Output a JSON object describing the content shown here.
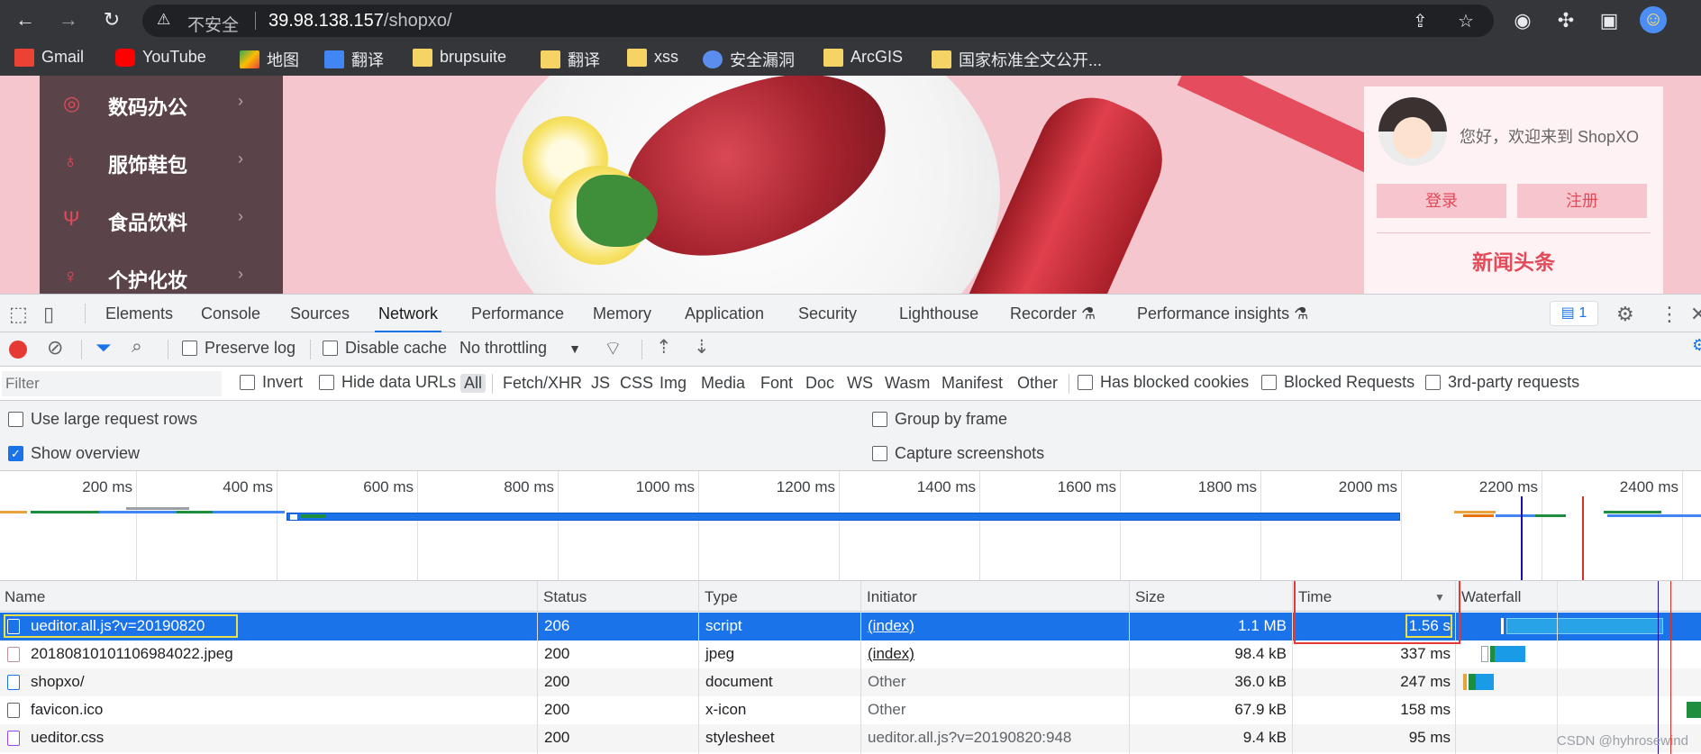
{
  "browser": {
    "insecure_label": "不安全",
    "url_host": "39.98.138.157",
    "url_path": "/shopxo/",
    "bookmarks": [
      {
        "label": "Gmail",
        "icon": "gmail-icon",
        "color": "#ea4335"
      },
      {
        "label": "YouTube",
        "icon": "youtube-icon",
        "color": "#ff0000"
      },
      {
        "label": "地图",
        "icon": "maps-icon",
        "color": "#34a853"
      },
      {
        "label": "翻译",
        "icon": "translate-icon",
        "color": "#4285f4"
      },
      {
        "label": "brupsuite",
        "icon": "folder-icon",
        "color": "#f6d365"
      },
      {
        "label": "翻译",
        "icon": "folder-icon",
        "color": "#f6d365"
      },
      {
        "label": "xss",
        "icon": "folder-icon",
        "color": "#f6d365"
      },
      {
        "label": "安全漏洞",
        "icon": "site-icon",
        "color": "#5b8def"
      },
      {
        "label": "ArcGIS",
        "icon": "folder-icon",
        "color": "#f6d365"
      },
      {
        "label": "国家标准全文公开...",
        "icon": "folder-icon",
        "color": "#f6d365"
      }
    ]
  },
  "page": {
    "categories": [
      {
        "label": "数码办公",
        "icon": "camera-icon"
      },
      {
        "label": "服饰鞋包",
        "icon": "shirt-icon"
      },
      {
        "label": "食品饮料",
        "icon": "cutlery-icon"
      },
      {
        "label": "个护化妆",
        "icon": "cosmetics-icon"
      }
    ],
    "welcome": "您好，欢迎来到 ShopXO",
    "login_label": "登录",
    "register_label": "注册",
    "news_heading": "新闻头条"
  },
  "devtools": {
    "tabs": [
      "Elements",
      "Console",
      "Sources",
      "Network",
      "Performance",
      "Memory",
      "Application",
      "Security",
      "Lighthouse",
      "Recorder",
      "Performance insights"
    ],
    "active_tab": "Network",
    "issues_count": "1",
    "toolbar": {
      "preserve_log": "Preserve log",
      "disable_cache": "Disable cache",
      "throttling": "No throttling"
    },
    "filter": {
      "placeholder": "Filter",
      "invert": "Invert",
      "hide_data_urls": "Hide data URLs",
      "types": [
        "All",
        "Fetch/XHR",
        "JS",
        "CSS",
        "Img",
        "Media",
        "Font",
        "Doc",
        "WS",
        "Wasm",
        "Manifest",
        "Other"
      ],
      "selected_type": "All",
      "has_blocked_cookies": "Has blocked cookies",
      "blocked_requests": "Blocked Requests",
      "third_party": "3rd-party requests"
    },
    "settings": {
      "large_rows": "Use large request rows",
      "group_by_frame": "Group by frame",
      "show_overview": "Show overview",
      "capture_screenshots": "Capture screenshots",
      "show_overview_checked": true
    },
    "overview_ticks": [
      "200 ms",
      "400 ms",
      "600 ms",
      "800 ms",
      "1000 ms",
      "1200 ms",
      "1400 ms",
      "1600 ms",
      "1800 ms",
      "2000 ms",
      "2200 ms",
      "2400 ms"
    ],
    "columns": [
      "Name",
      "Status",
      "Type",
      "Initiator",
      "Size",
      "Time",
      "Waterfall"
    ],
    "rows": [
      {
        "name": "ueditor.all.js?v=20190820",
        "status": "206",
        "type": "script",
        "initiator": "(index)",
        "size": "1.1 MB",
        "time": "1.56 s",
        "icon": "script-file-icon"
      },
      {
        "name": "20180810101106984022.jpeg",
        "status": "200",
        "type": "jpeg",
        "initiator": "(index)",
        "size": "98.4 kB",
        "time": "337 ms",
        "icon": "image-file-icon"
      },
      {
        "name": "shopxo/",
        "status": "200",
        "type": "document",
        "initiator": "Other",
        "size": "36.0 kB",
        "time": "247 ms",
        "icon": "document-file-icon"
      },
      {
        "name": "favicon.ico",
        "status": "200",
        "type": "x-icon",
        "initiator": "Other",
        "size": "67.9 kB",
        "time": "158 ms",
        "icon": "file-icon"
      },
      {
        "name": "ueditor.css",
        "status": "200",
        "type": "stylesheet",
        "initiator": "ueditor.all.js?v=20190820:948",
        "size": "9.4 kB",
        "time": "95 ms",
        "icon": "stylesheet-file-icon"
      }
    ]
  },
  "watermark": "CSDN @hyhrosewind"
}
